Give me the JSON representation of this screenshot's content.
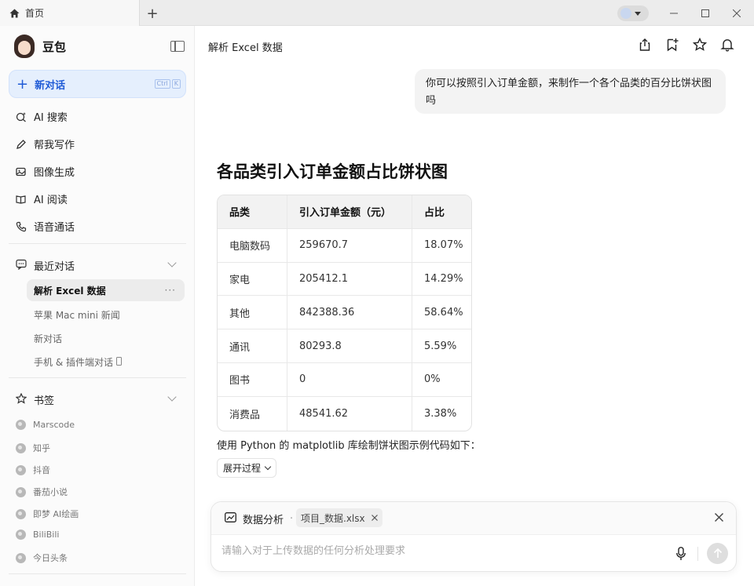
{
  "tab": {
    "title": "首页",
    "icon": "home-icon"
  },
  "app": {
    "name": "豆包"
  },
  "sidebar": {
    "new_chat": {
      "label": "新对话",
      "shortcut": [
        "Ctrl",
        "K"
      ]
    },
    "nav": [
      {
        "label": "AI 搜索",
        "icon": "search-sparkle-icon"
      },
      {
        "label": "帮我写作",
        "icon": "pen-icon"
      },
      {
        "label": "图像生成",
        "icon": "image-icon"
      },
      {
        "label": "AI 阅读",
        "icon": "book-icon"
      },
      {
        "label": "语音通话",
        "icon": "phone-icon"
      }
    ],
    "recent": {
      "title": "最近对话",
      "items": [
        "解析 Excel 数据",
        "苹果 Mac mini 新闻",
        "新对话",
        "手机 & 插件端对话"
      ],
      "active_more": "···"
    },
    "bookmarks": {
      "title": "书签",
      "items": [
        "Marscode",
        "知乎",
        "抖音",
        "番茄小说",
        "即梦 AI绘画",
        "BiliBili",
        "今日头条"
      ]
    }
  },
  "main": {
    "title": "解析 Excel 数据",
    "user_message": "你可以按照引入订单金额，来制作一个各个品类的百分比饼状图吗",
    "heading": "各品类引入订单金额占比饼状图",
    "table": {
      "headers": [
        "品类",
        "引入订单金额（元）",
        "占比"
      ],
      "rows": [
        [
          "电脑数码",
          "259670.7",
          "18.07%"
        ],
        [
          "家电",
          "205412.1",
          "14.29%"
        ],
        [
          "其他",
          "842388.36",
          "58.64%"
        ],
        [
          "通讯",
          "80293.8",
          "5.59%"
        ],
        [
          "图书",
          "0",
          "0%"
        ],
        [
          "消费品",
          "48541.62",
          "3.38%"
        ]
      ]
    },
    "paragraph": "使用 Python 的 matplotlib 库绘制饼状图示例代码如下：",
    "expand_label": "展开过程"
  },
  "composer": {
    "mode_label": "数据分析",
    "separator": "·",
    "file_chip": "项目_数据.xlsx",
    "placeholder": "请输入对于上传数据的任何分析处理要求"
  }
}
